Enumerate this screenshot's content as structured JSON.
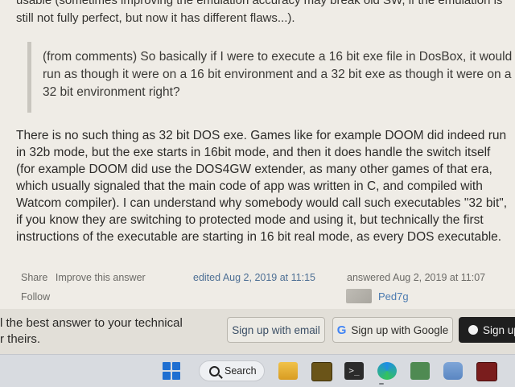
{
  "post": {
    "top_line_1": "usable (sometimes improving the emulation accuracy may break old SW, if the emulation is",
    "top_line_2": "still not fully perfect, but now it has different flaws...).",
    "quote": "(from comments) So basically if I were to execute a 16 bit exe file in DosBox, it would run as though it were on a 16 bit environment and a 32 bit exe as though it were on a 32 bit environment right?",
    "answer": "There is no such thing as 32 bit DOS exe. Games like for example DOOM did indeed run in 32b mode, but the exe starts in 16bit mode, and then it does handle the switch itself (for example DOOM did use the DOS4GW extender, as many other games of that era, which usually signaled that the main code of app was written in C, and compiled with Watcom compiler). I can understand why somebody would call such executables \"32 bit\", if you know they are switching to protected mode and using it, but technically the first instructions of the executable are starting in 16 bit real mode, as every DOS executable."
  },
  "meta": {
    "share": "Share",
    "improve": "Improve this answer",
    "follow": "Follow",
    "edited": "edited Aug 2, 2019 at 11:15",
    "answered": "answered Aug 2, 2019 at 11:07",
    "user": "Ped7g"
  },
  "banner": {
    "line1": "l the best answer to your technical",
    "line2": "r theirs.",
    "email_btn": "Sign up with email",
    "google_btn": "Sign up with Google",
    "github_btn": "Sign up"
  },
  "taskbar": {
    "search_label": "Search",
    "icons": [
      "windows-start-icon",
      "search-icon",
      "file-explorer-icon",
      "app-icon",
      "terminal-icon",
      "edge-icon",
      "app-icon",
      "app-icon",
      "app-icon"
    ]
  },
  "colors": {
    "background": "#efece6",
    "link": "#4c7bb0",
    "github_button": "#1f1f1f",
    "start_blue": "#1f6fd1"
  }
}
